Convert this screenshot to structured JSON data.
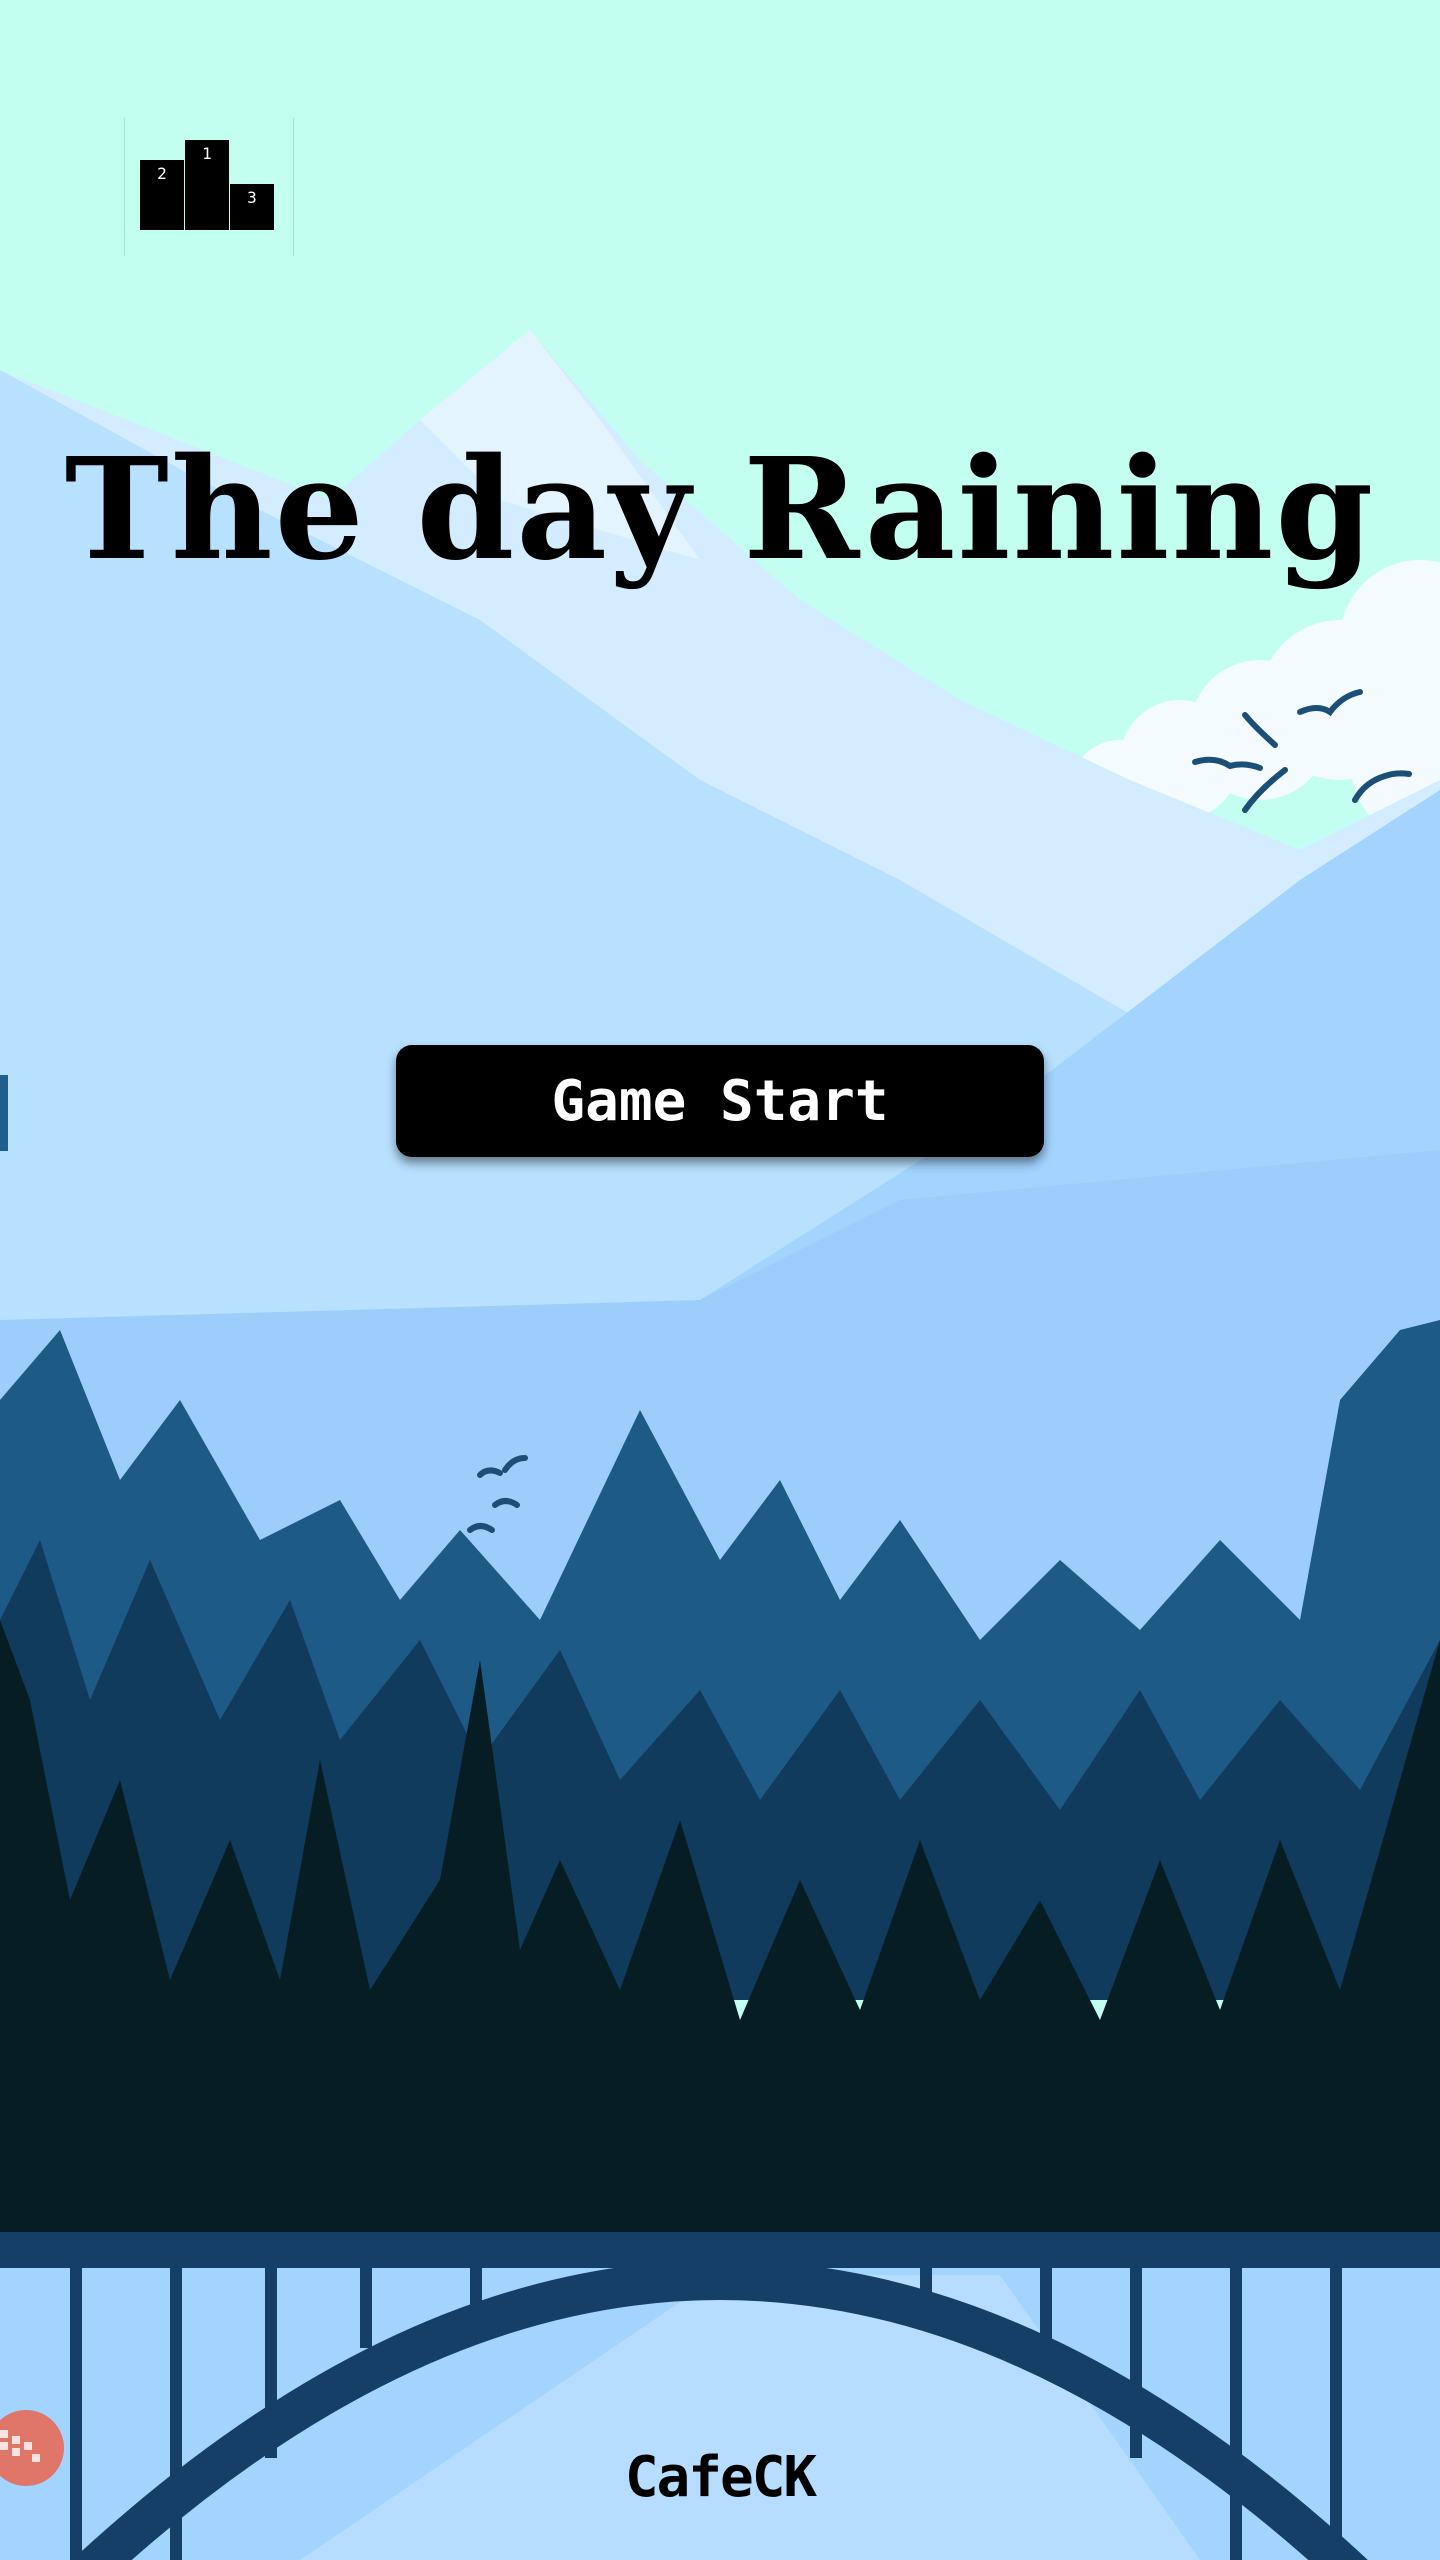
{
  "title": "The day Raining",
  "start_button_label": "Game Start",
  "brand": "CafeCK",
  "leaderboard": {
    "first": "1",
    "second": "2",
    "third": "3"
  },
  "icons": {
    "leaderboard": "podium-icon",
    "floating": "gamepad-icon"
  },
  "colors": {
    "sky": "#c2fff0",
    "mountain_light": "#d3ecff",
    "mountain_mid": "#addbff",
    "forest_far": "#1d5a85",
    "forest_near": "#061d23",
    "bridge": "#163f67",
    "button": "#000000",
    "gamepad": "#e0756a"
  }
}
